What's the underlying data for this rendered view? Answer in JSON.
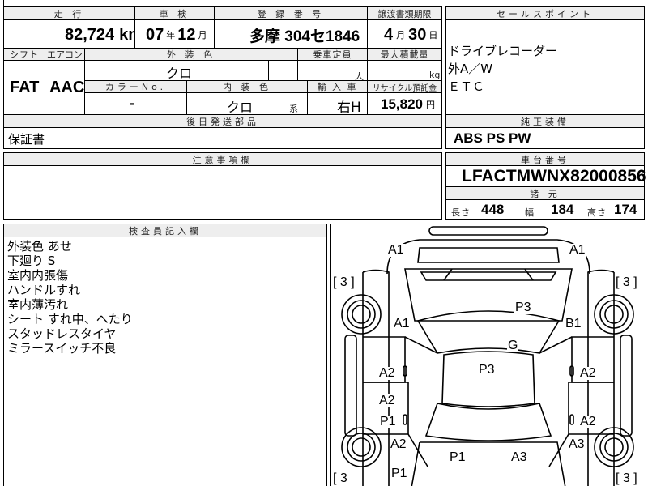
{
  "top": {
    "mileage_label": "走 行",
    "mileage_value": "82,724",
    "mileage_unit": "km",
    "inspection_label": "車 検",
    "inspection_year": "07",
    "inspection_year_unit": "年",
    "inspection_month": "12",
    "inspection_month_unit": "月",
    "registration_label": "登 録 番 号",
    "registration_value": "多摩 304セ1846",
    "transfer_label": "譲渡書類期限",
    "transfer_month": "4",
    "transfer_month_unit": "月",
    "transfer_day": "30",
    "transfer_day_unit": "日"
  },
  "specs": {
    "shift_label": "シフト",
    "shift_value": "FAT",
    "ac_label": "エアコン",
    "ac_value": "AAC",
    "ext_color_label": "外 装 色",
    "ext_color_value": "クロ",
    "capacity_label": "乗車定員",
    "capacity_unit": "人",
    "load_label": "最大積載量",
    "load_unit": "kg",
    "color_no_label": "カラーNo.",
    "color_no_value": "-",
    "int_color_label": "内 装 色",
    "int_color_value": "クロ",
    "int_color_suffix": "系",
    "import_label": "輸 入 車",
    "import_value": "右H",
    "recycle_label": "リサイクル預託金",
    "recycle_value": "15,820",
    "recycle_unit": "円"
  },
  "sales_points": {
    "label": "セールスポイント",
    "items": [
      "ドライブレコーダー",
      "外A／W",
      "ＥＴＣ"
    ]
  },
  "post_shipping": {
    "label": "後日発送部品",
    "value": "保証書"
  },
  "genuine": {
    "label": "純正装備",
    "value": "ABS PS PW"
  },
  "notes": {
    "label": "注意事項欄"
  },
  "chassis": {
    "label": "車台番号",
    "value": "LFACTMWNX82000856",
    "dims_label": "諸 元",
    "length_label": "長さ",
    "length_value": "448",
    "width_label": "幅",
    "width_value": "184",
    "height_label": "高さ",
    "height_value": "174"
  },
  "inspector": {
    "label": "検査員記入欄",
    "lines": [
      "外装色 あせ",
      "下廻り S",
      "室内内張傷",
      "ハンドルすれ",
      "室内薄汚れ",
      "シート すれ中、へたり",
      "スタッドレスタイヤ",
      "ミラースイッチ不良"
    ]
  },
  "diagram": {
    "tire_left_front": "[ 3 ]",
    "tire_right_front": "[ 3 ]",
    "tire_left_rear": "[ 3",
    "tire_right_rear": "[ 3 ]",
    "marks": {
      "a1_front_left": "A1",
      "a1_front_right": "A1",
      "a1_left_fender": "A1",
      "b1_right_fender": "B1",
      "p3_hood": "P3",
      "g_windshield": "G",
      "p3_roof": "P3",
      "a2_left_front_door": "A2",
      "a2_right_front_door": "A2",
      "a2_left_rear_door": "A2",
      "p1_left_rear_door": "P1",
      "a2_right_rear_door": "A2",
      "a2_left_quarter": "A2",
      "a3_right_quarter": "A3",
      "p1_rear_left": "P1",
      "p1_rear_center": "P1",
      "a3_rear_right": "A3"
    }
  }
}
